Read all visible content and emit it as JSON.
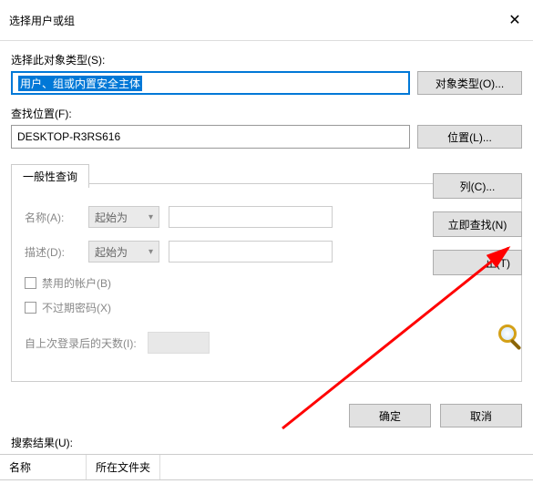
{
  "window": {
    "title": "选择用户或组"
  },
  "object_type": {
    "label": "选择此对象类型(S):",
    "selected": "用户、组或内置安全主体",
    "button": "对象类型(O)..."
  },
  "location": {
    "label": "查找位置(F):",
    "value": "DESKTOP-R3RS616",
    "button": "位置(L)..."
  },
  "tabs": {
    "general": "一般性查询"
  },
  "query": {
    "name_label": "名称(A):",
    "desc_label": "描述(D):",
    "starts_with": "起始为",
    "disabled_label": "禁用的帐户(B)",
    "noexpire_label": "不过期密码(X)",
    "days_label": "自上次登录后的天数(I):"
  },
  "side_buttons": {
    "columns": "列(C)...",
    "find_now": "立即查找(N)",
    "stop": "止(T)"
  },
  "dialog": {
    "ok": "确定",
    "cancel": "取消"
  },
  "results": {
    "label": "搜索结果(U):",
    "col_name": "名称",
    "col_folder": "所在文件夹"
  }
}
